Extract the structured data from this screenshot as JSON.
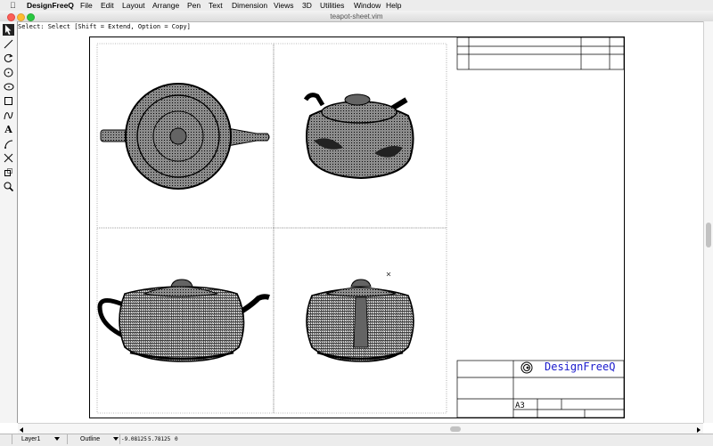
{
  "menubar": {
    "apple": "",
    "app": "DesignFreeQ",
    "items": [
      "File",
      "Edit",
      "Layout",
      "Arrange",
      "Pen",
      "Text",
      "Dimension",
      "Views",
      "3D",
      "Utilities",
      "Window",
      "Help"
    ]
  },
  "window": {
    "title": "teapot-sheet.vim"
  },
  "status_hint": "Select: Select [Shift = Extend, Option = Copy]",
  "toolbar": {
    "tools": [
      "arrow-icon",
      "line-icon",
      "rotate-icon",
      "circle-icon",
      "ellipse-icon",
      "rectangle-icon",
      "curve-icon",
      "text-icon",
      "arc-icon",
      "trim-icon",
      "scale-icon",
      "zoom-icon"
    ],
    "text_tool_glyph": "A"
  },
  "title_block": {
    "company": "DesignFreeQ",
    "sheet_size": "A3",
    "text_color": "#1a1acc"
  },
  "statusbar": {
    "layer": "Layer1",
    "mode": "Outline",
    "x": "-9.08125",
    "y": "5.78125",
    "z": "0"
  }
}
